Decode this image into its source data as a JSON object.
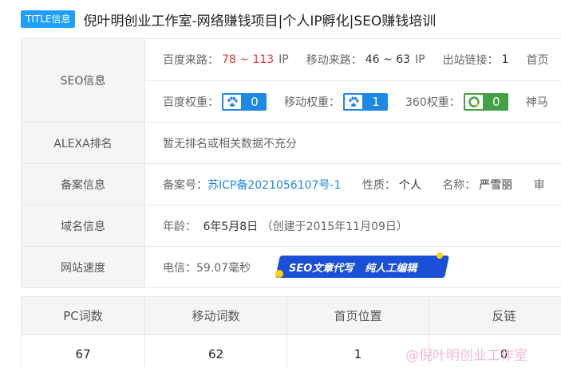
{
  "title": {
    "badge": "TITLE信息",
    "text": "倪叶明创业工作室-网络赚钱项目|个人IP孵化|SEO赚钱培训"
  },
  "seo": {
    "label": "SEO信息",
    "baidu_traffic_label": "百度来路：",
    "baidu_traffic_value": "78 ~ 113",
    "baidu_traffic_unit": "IP",
    "mobile_traffic_label": "移动来路：",
    "mobile_traffic_value": "46 ~ 63",
    "mobile_traffic_unit": "IP",
    "outlinks_label": "出站链接：",
    "outlinks_value": "1",
    "home_label": "首页",
    "baidu_weight_label": "百度权重：",
    "baidu_weight_value": "0",
    "mobile_weight_label": "移动权重：",
    "mobile_weight_value": "1",
    "w360_label": "360权重：",
    "w360_value": "0",
    "shenma_label": "神马"
  },
  "alexa": {
    "label": "ALEXA排名",
    "value": "暂无排名或相关数据不充分"
  },
  "icp": {
    "label": "备案信息",
    "number_label": "备案号：",
    "number_value": "苏ICP备2021056107号-1",
    "nature_label": "性质：",
    "nature_value": "个人",
    "name_label": "名称：",
    "name_value": "严雪丽",
    "audit_label": "审"
  },
  "domain": {
    "label": "域名信息",
    "age_label": "年龄：",
    "age_value": "6年5月8日",
    "created": "（创建于2015年11月09日）"
  },
  "speed": {
    "label": "网站速度",
    "value": "电信：59.07毫秒"
  },
  "promo": {
    "left": "SEO文章代写",
    "right": "纯人工编辑"
  },
  "keywords": {
    "headers": [
      "PC词数",
      "移动词数",
      "首页位置",
      "反链"
    ],
    "values": [
      "67",
      "62",
      "1",
      "0"
    ]
  },
  "watermark": "@倪叶明创业工作室",
  "colors": {
    "accent_blue": "#1e88e5",
    "traffic_red": "#e53935",
    "green_360": "#43a047",
    "badge_blue": "#1e9fff"
  },
  "icons": {
    "baidu": "baidu-paw-icon",
    "mobile": "baidu-paw-icon",
    "w360": "360-logo-icon"
  }
}
